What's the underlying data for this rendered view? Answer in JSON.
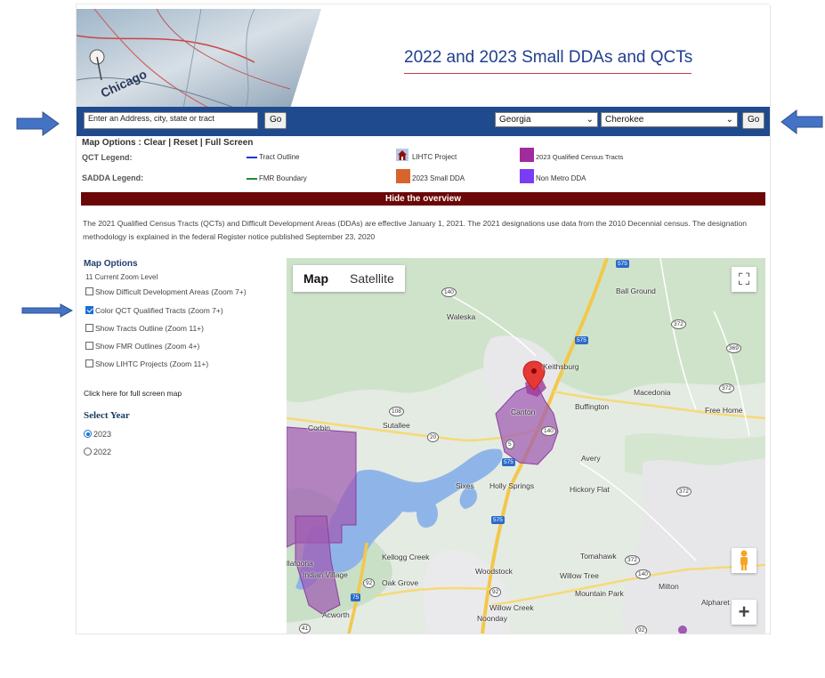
{
  "header": {
    "title": "2022 and 2023 Small DDAs and QCTs",
    "banner_image": "map-banner-chicago"
  },
  "search": {
    "address_value": "Enter an Address, city, state or tract",
    "go_label": "Go",
    "state_value": "Georgia",
    "county_value": "Cherokee",
    "go2_label": "Go"
  },
  "map_options_bar": {
    "label": "Map Options :",
    "clear": "Clear",
    "reset": "Reset",
    "fullscreen": "Full Screen",
    "sep": "|"
  },
  "legend": {
    "qct_label": "QCT Legend:",
    "sadda_label": "SADDA Legend:",
    "tract_outline": "Tract Outline",
    "fmr_boundary": "FMR Boundary",
    "lihtc_project": "LIHTC Project",
    "small_dda": "2023 Small DDA",
    "qualified_tracts": "2023 Qualified Census Tracts",
    "non_metro_dda": "Non Metro DDA",
    "colors": {
      "tract_outline": "#1a35d6",
      "fmr_boundary": "#1f8f2a",
      "small_dda": "#d7642d",
      "qualified_tracts": "#a12b9c",
      "non_metro_dda": "#7a3cf5"
    }
  },
  "overview": {
    "toggle_label": "Hide the overview",
    "text": "The 2021 Qualified Census Tracts (QCTs) and Difficult Development Areas (DDAs) are effective January 1, 2021. The 2021 designations use data from the 2010 Decennial census. The designation methodology is explained in the federal Register notice published September 23, 2020"
  },
  "options_panel": {
    "title": "Map Options",
    "zoom_level": "11 Current Zoom Level",
    "checkboxes": [
      {
        "label": "Show Difficult Development Areas (Zoom 7+)",
        "checked": false
      },
      {
        "label": "Color QCT Qualified Tracts (Zoom 7+)",
        "checked": true
      },
      {
        "label": "Show Tracts Outline (Zoom 11+)",
        "checked": false
      },
      {
        "label": "Show FMR Outlines (Zoom 4+)",
        "checked": false
      },
      {
        "label": "Show LIHTC Projects (Zoom 11+)",
        "checked": false
      }
    ],
    "fullscreen_link": "Click here for full screen map",
    "year_title": "Select Year",
    "years": [
      {
        "label": "2023",
        "selected": true
      },
      {
        "label": "2022",
        "selected": false
      }
    ]
  },
  "map": {
    "type_map": "Map",
    "type_satellite": "Satellite",
    "zoom_in": "+",
    "places": {
      "ball_ground": "Ball Ground",
      "waleska": "Waleska",
      "keithsburg": "Keithsburg",
      "macedonia": "Macedonia",
      "canton": "Canton",
      "buffington": "Buffington",
      "free_home": "Free Home",
      "corbin": "Corbin",
      "sutallee": "Sutallee",
      "avery": "Avery",
      "sixes": "Sixes",
      "holly_springs": "Holly Springs",
      "hickory_flat": "Hickory Flat",
      "kellogg_creek": "Kellogg Creek",
      "woodstock": "Woodstock",
      "tomahawk": "Tomahawk",
      "allatoona": "llatoona",
      "indian_village": "Indian Village",
      "oak_grove": "Oak Grove",
      "willow_tree": "Willow Tree",
      "milton": "Milton",
      "mountain_park": "Mountain Park",
      "willow_creek": "Willow Creek",
      "noonday": "Noonday",
      "acworth": "Acworth",
      "alpharetta": "Alpharet"
    },
    "shields": {
      "i575_a": "575",
      "i575_b": "575",
      "i575_c": "575",
      "i575_d": "575",
      "i75": "75",
      "r140_a": "140",
      "r140_b": "140",
      "r140_c": "140",
      "r372_a": "372",
      "r372_b": "372",
      "r372_c": "372",
      "r372_d": "372",
      "r369": "369",
      "r108": "108",
      "r20": "20",
      "r5": "5",
      "r92_a": "92",
      "r92_b": "92",
      "r92_c": "92",
      "r41": "41"
    }
  }
}
